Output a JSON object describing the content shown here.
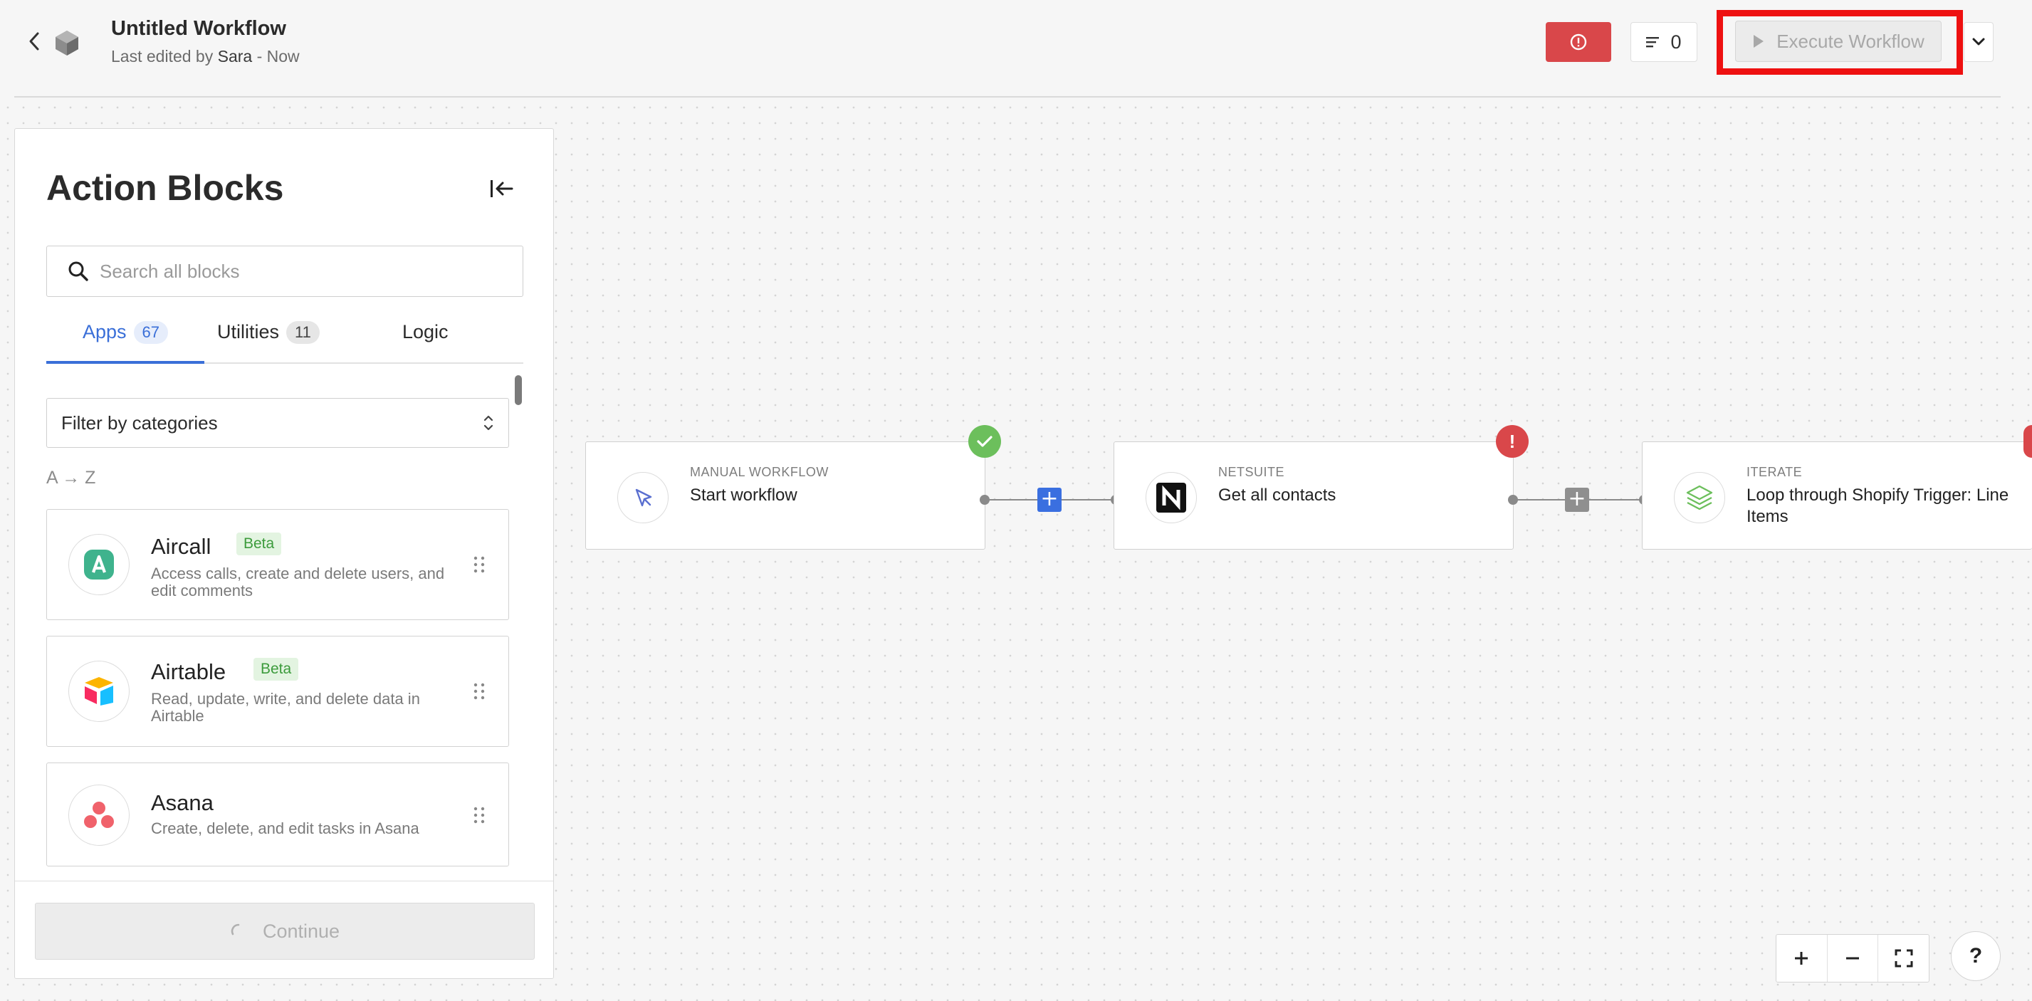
{
  "header": {
    "title": "Untitled Workflow",
    "subtitle_prefix": "Last edited by ",
    "subtitle_user": "Sara",
    "subtitle_suffix": " - Now",
    "log_count": "0",
    "execute_label": "Execute Workflow",
    "accent_error": "#d9474a",
    "highlight_color": "#ee1111"
  },
  "sidebar": {
    "title": "Action Blocks",
    "search": {
      "placeholder": "Search all blocks",
      "value": ""
    },
    "tabs": [
      {
        "label": "Apps",
        "count": "67",
        "active": true
      },
      {
        "label": "Utilities",
        "count": "11",
        "active": false
      },
      {
        "label": "Logic",
        "count": "",
        "active": false
      }
    ],
    "filter": {
      "value": "Filter by categories"
    },
    "sort_label": "A → Z",
    "apps": [
      {
        "name": "Aircall",
        "badge": "Beta",
        "description": "Access calls, create and delete users, and edit comments",
        "icon": "aircall-icon"
      },
      {
        "name": "Airtable",
        "badge": "Beta",
        "description": "Read, update, write, and delete data in Airtable",
        "icon": "airtable-icon"
      },
      {
        "name": "Asana",
        "badge": "",
        "description": "Create, delete, and edit tasks in Asana",
        "icon": "asana-icon"
      }
    ],
    "continue_label": "Continue"
  },
  "workflow": {
    "nodes": [
      {
        "type": "MANUAL WORKFLOW",
        "label": "Start workflow",
        "status": "ok",
        "icon": "cursor-icon"
      },
      {
        "type": "NETSUITE",
        "label": "Get all contacts",
        "status": "error",
        "icon": "netsuite-icon"
      },
      {
        "type": "ITERATE",
        "label": "Loop through Shopify Trigger: Line Items",
        "status": "error",
        "icon": "layers-icon"
      }
    ],
    "status_ok_color": "#6cbf5c",
    "status_error_color": "#d9474a",
    "status_error_symbol": "!"
  },
  "controls": {
    "help_label": "?"
  }
}
